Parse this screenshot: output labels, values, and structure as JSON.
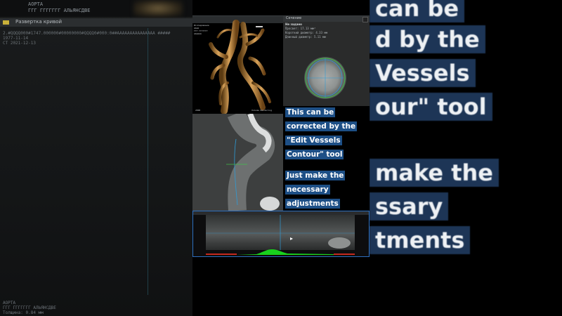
{
  "left_window": {
    "top_strip_line1": "АОРТА",
    "top_strip_line2": "ГГГ ГГГГГГГ АЛЬЯНСДВЕ",
    "title": "Развертка кривой",
    "meta_line1": "2.#QQQQ000#1747.000000#00000000#QQQQ0#000:0##ААААААААААААААА #####",
    "meta_line2": "1977-11-14",
    "meta_line3": "СТ 2021-12-13",
    "bottom_line1": "АОРТА",
    "bottom_line2": "ГГГ ГГГГГГГ АЛЬЯНСДВЕ",
    "bottom_line3": "Толщина: 0.84 мм"
  },
  "viewer_3d": {
    "overlay_lines": [
      "Исследование",
      "АААА",
      "ГГГ ГГГГГГГ",
      "АААААА"
    ],
    "scale_label": "2000",
    "volume_label": "Volume Rendering"
  },
  "cross_section": {
    "title": "Сечение",
    "subtitle": "Не задано",
    "rows": [
      "Просвет: 17.13 мм²",
      "Короткий диаметр: 4.33 мм",
      "Длинный диаметр: 5.11 мм"
    ]
  },
  "caption": {
    "block1": [
      "This can be",
      "corrected by the",
      "\"Edit Vessels",
      "Contour\" tool"
    ],
    "block2": [
      "Just make the",
      "necessary",
      "adjustments"
    ]
  },
  "background_right": {
    "lines": [
      "can be",
      "d by the",
      "Vessels",
      "our\" tool",
      "make the",
      "ssary",
      "tments"
    ]
  },
  "colors": {
    "caption_bg": "#1d4f86",
    "selection_border": "#2d6fbf",
    "profile_green": "#19d11d",
    "profile_red": "#c4281e"
  }
}
